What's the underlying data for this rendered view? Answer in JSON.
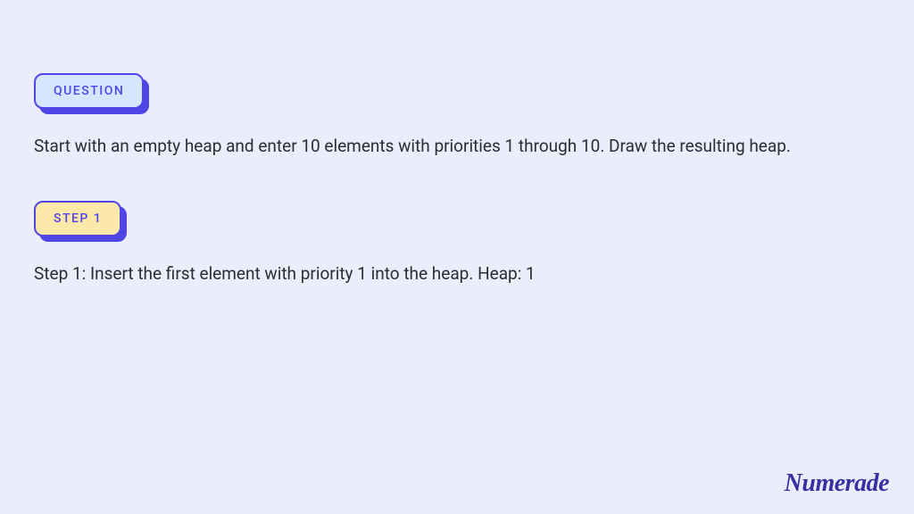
{
  "question": {
    "badge_label": "QUESTION",
    "text": "Start with an empty heap and enter 10 elements with priorities 1 through 10. Draw the resulting heap."
  },
  "step": {
    "badge_label": "STEP 1",
    "text": "Step 1: Insert the first element with priority 1 into the heap. Heap: 1"
  },
  "brand": "Numerade"
}
